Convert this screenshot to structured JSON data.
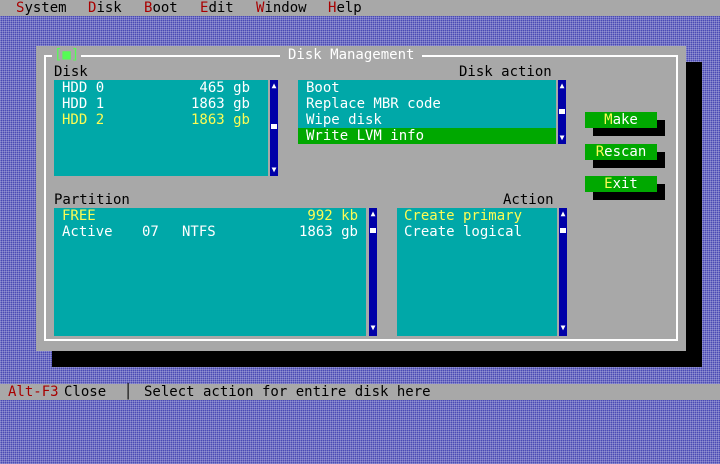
{
  "menu": [
    {
      "hotkey": "S",
      "rest": "ystem"
    },
    {
      "hotkey": "D",
      "rest": "isk"
    },
    {
      "hotkey": "B",
      "rest": "oot"
    },
    {
      "hotkey": "E",
      "rest": "dit"
    },
    {
      "hotkey": "W",
      "rest": "indow"
    },
    {
      "hotkey": "H",
      "rest": "elp"
    }
  ],
  "dialog": {
    "title": "Disk Management",
    "close_glyph": "[■]"
  },
  "disk_section": {
    "label": "Disk",
    "items": [
      {
        "name": "HDD 0",
        "size": "465 gb"
      },
      {
        "name": "HDD 1",
        "size": "1863 gb"
      },
      {
        "name": "HDD 2",
        "size": "1863 gb"
      }
    ]
  },
  "disk_action_section": {
    "label": "Disk action",
    "items": [
      "Boot",
      "Replace MBR code",
      "Wipe disk",
      "Write LVM info"
    ]
  },
  "partition_section": {
    "label": "Partition",
    "items": [
      {
        "status": "FREE",
        "type": "",
        "fs": "",
        "size": "992 kb"
      },
      {
        "status": "Active",
        "type": "07",
        "fs": "NTFS",
        "size": "1863 gb"
      }
    ]
  },
  "action_section": {
    "label": "Action",
    "items": [
      "Create primary",
      "Create logical"
    ]
  },
  "buttons": {
    "make": {
      "hotkey": "M",
      "rest": "ake"
    },
    "rescan": {
      "hotkey": "R",
      "rest": "escan"
    },
    "exit": {
      "hotkey": "E",
      "rest": "xit"
    }
  },
  "statusbar": {
    "key": "Alt-F3",
    "key_label": "Close",
    "separator": "│",
    "message": "Select action for entire disk here"
  },
  "colors": {
    "background": "#4a4ab4",
    "dialog": "#a8a8a8",
    "list": "#00a8a8",
    "selected": "#00a800",
    "scrollbar": "#0000a8",
    "hotkey": "#a80000",
    "highlight_text": "#fcfc54"
  }
}
